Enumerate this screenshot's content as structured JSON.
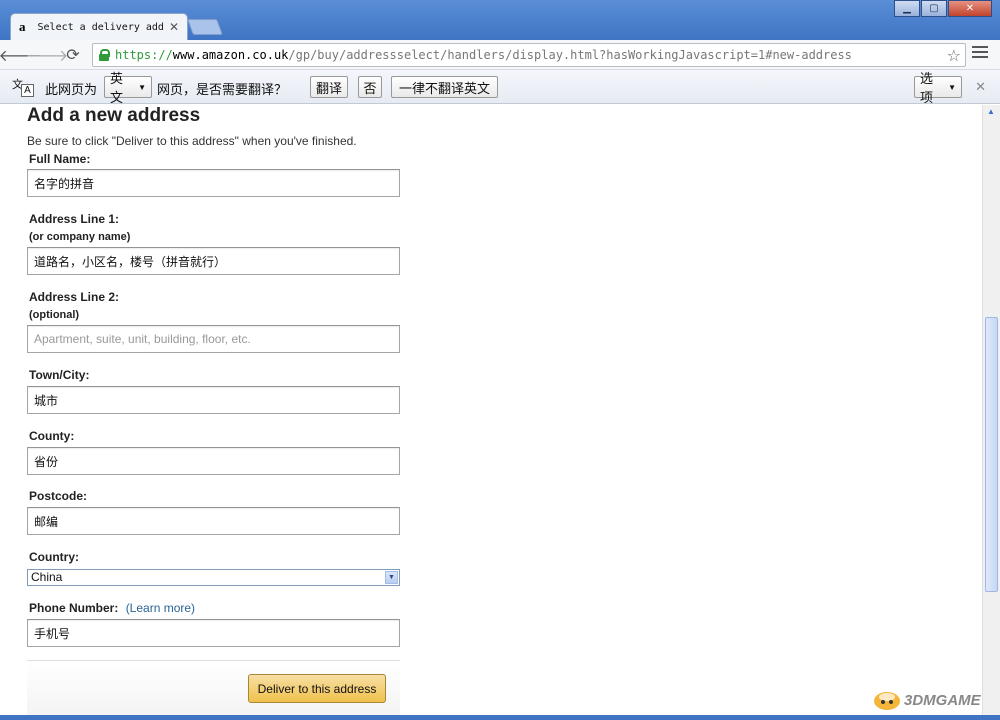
{
  "browser": {
    "tab_favicon": "a",
    "tab_title": "Select a delivery addre",
    "tab_close": "✕",
    "url_scheme": "https://",
    "url_host": "www.amazon.co.uk",
    "url_path": "/gp/buy/addressselect/handlers/display.html?hasWorkingJavascript=1#new-address",
    "star_icon": "☆"
  },
  "translate_bar": {
    "prefix": "此网页为",
    "language": "英文",
    "question": "网页，是否需要翻译？",
    "translate_button": "翻译",
    "no_button": "否",
    "never_button": "一律不翻译英文",
    "options_button": "选项"
  },
  "form": {
    "heading": "Add a new address",
    "instruction": "Be sure to click \"Deliver to this address\" when you've finished.",
    "full_name_label": "Full Name:",
    "full_name_value": "名字的拼音",
    "address1_label": "Address Line 1:",
    "address1_sublabel": "(or company name)",
    "address1_value": "道路名，小区名，楼号（拼音就行）",
    "address2_label": "Address Line 2:",
    "address2_sublabel": "(optional)",
    "address2_placeholder": "Apartment, suite, unit, building, floor, etc.",
    "town_label": "Town/City:",
    "town_value": "城市",
    "county_label": "County:",
    "county_value": "省份",
    "postcode_label": "Postcode:",
    "postcode_value": "邮编",
    "country_label": "Country:",
    "country_value": "China",
    "phone_label": "Phone Number:",
    "learn_more": "(Learn more)",
    "phone_value": "手机号",
    "submit_button": "Deliver to this address"
  },
  "watermark": {
    "text": "3DMGAME"
  }
}
